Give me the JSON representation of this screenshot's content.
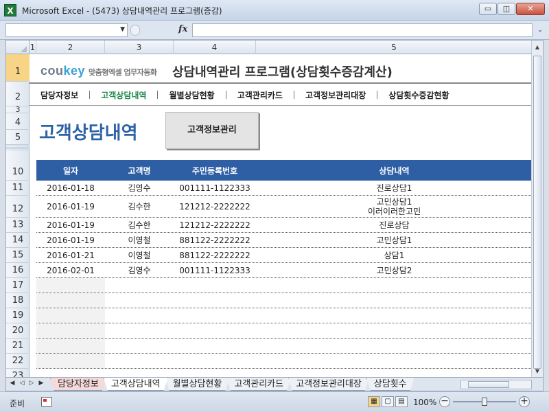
{
  "window": {
    "title": "Microsoft Excel - (5473) 상담내역관리 프로그램(증감)",
    "minimize": "▭",
    "restore": "◫",
    "close": "✕"
  },
  "formula_bar": {
    "fx": "fx",
    "name_box": "",
    "formula": ""
  },
  "columns": [
    "1",
    "2",
    "3",
    "4",
    "5"
  ],
  "rows": [
    "1",
    "2",
    "3",
    "4",
    "5",
    "10",
    "11",
    "12",
    "13",
    "14",
    "15",
    "16",
    "17",
    "18",
    "19",
    "20",
    "21",
    "22",
    "23"
  ],
  "header": {
    "logo": "cou",
    "logo_k": "key",
    "logo_sub": "맞춤형엑셀 업무자동화",
    "app_title": "상담내역관리 프로그램(상담횟수증감계산)"
  },
  "nav": [
    "담당자정보",
    "고객상담내역",
    "월별상담현황",
    "고객관리카드",
    "고객정보관리대장",
    "상담횟수증감현황"
  ],
  "page": {
    "title": "고객상담내역",
    "button": "고객정보관리"
  },
  "table": {
    "headers": [
      "일자",
      "고객명",
      "주민등록번호",
      "상담내역"
    ],
    "rows": [
      [
        "2016-01-18",
        "김영수",
        "001111-1122333",
        "진로상담1"
      ],
      [
        "2016-01-19",
        "김수한",
        "121212-2222222",
        "고민상담1\n이러이러한고민"
      ],
      [
        "2016-01-19",
        "김수한",
        "121212-2222222",
        "진로상담"
      ],
      [
        "2016-01-19",
        "이영철",
        "881122-2222222",
        "고민상담1"
      ],
      [
        "2016-01-21",
        "이영철",
        "881122-2222222",
        "상담1"
      ],
      [
        "2016-02-01",
        "김영수",
        "001111-1122333",
        "고민상담2"
      ]
    ]
  },
  "sheet_tabs": [
    "담당자정보",
    "고객상담내역",
    "월별상담현황",
    "고객관리카드",
    "고객정보관리대장",
    "상담횟수"
  ],
  "status": {
    "text": "준비",
    "zoom": "100%"
  },
  "colors": {
    "accent": "#2e5fa5",
    "nav_active": "#1f8a4c",
    "title_blue": "#2d63a6"
  }
}
